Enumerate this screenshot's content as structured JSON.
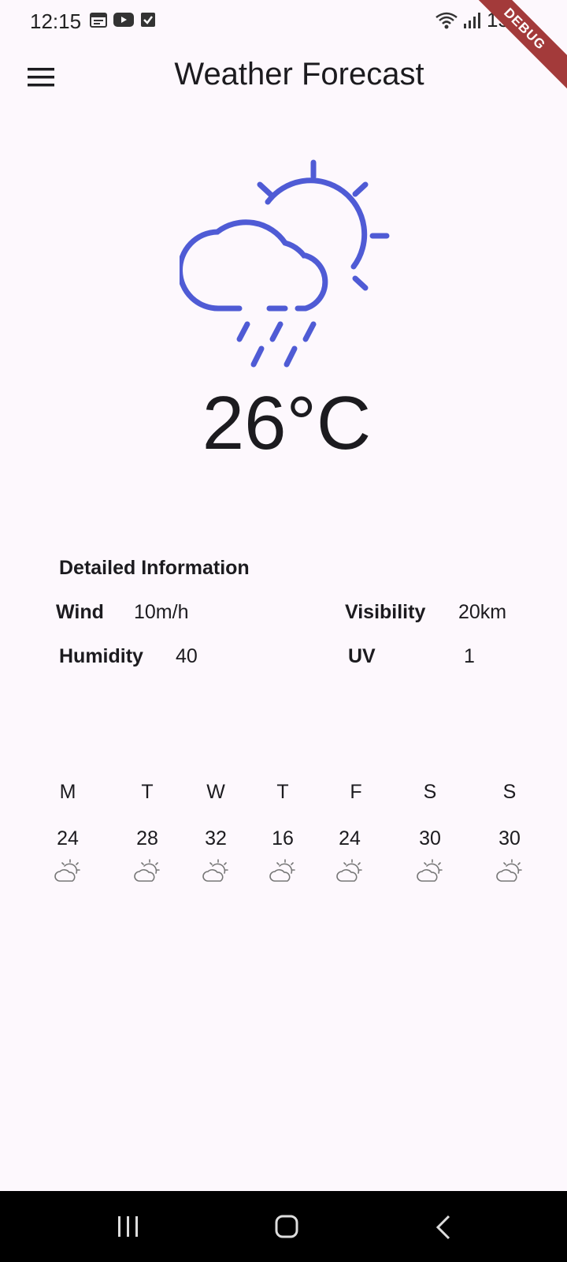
{
  "status_bar": {
    "time": "12:15",
    "battery": "15%",
    "debug_label": "DEBUG"
  },
  "app_bar": {
    "title": "Weather Forecast",
    "menu_icon": "hamburger-menu-icon"
  },
  "current": {
    "icon": "partly-cloudy-rain-icon",
    "temperature": "26°C",
    "accent_color": "#4f5bd5"
  },
  "details": {
    "title": "Detailed Information",
    "wind": {
      "label": "Wind",
      "value": "10m/h"
    },
    "visibility": {
      "label": "Visibility",
      "value": "20km"
    },
    "humidity": {
      "label": "Humidity",
      "value": "40"
    },
    "uv": {
      "label": "UV",
      "value": "1"
    }
  },
  "week": [
    {
      "day": "M",
      "temp": "24",
      "icon": "partly-cloudy-icon"
    },
    {
      "day": "T",
      "temp": "28",
      "icon": "partly-cloudy-icon"
    },
    {
      "day": "W",
      "temp": "32",
      "icon": "partly-cloudy-icon"
    },
    {
      "day": "T",
      "temp": "16",
      "icon": "partly-cloudy-icon"
    },
    {
      "day": "F",
      "temp": "24",
      "icon": "partly-cloudy-icon"
    },
    {
      "day": "S",
      "temp": "30",
      "icon": "partly-cloudy-icon"
    },
    {
      "day": "S",
      "temp": "30",
      "icon": "partly-cloudy-icon"
    }
  ]
}
